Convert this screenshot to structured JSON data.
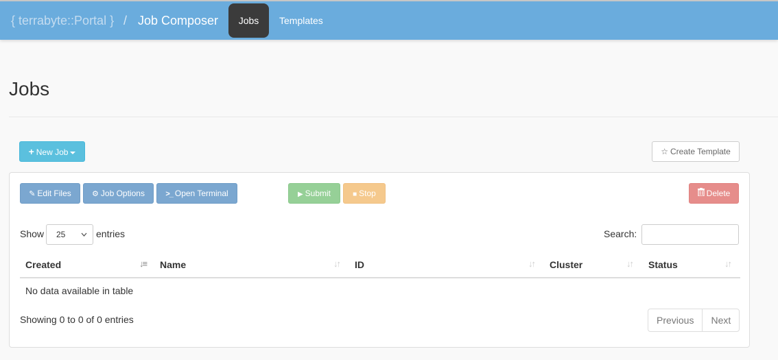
{
  "navbar": {
    "brand": "{ terrabyte::Portal }",
    "separator": "/",
    "app_title": "Job Composer",
    "items": [
      {
        "label": "Jobs",
        "active": true
      },
      {
        "label": "Templates",
        "active": false
      }
    ]
  },
  "page": {
    "title": "Jobs"
  },
  "toolbar": {
    "new_job": "New Job",
    "create_template": "Create Template",
    "edit_files": "Edit Files",
    "job_options": "Job Options",
    "open_terminal": "Open Terminal",
    "submit": "Submit",
    "stop": "Stop",
    "delete": "Delete"
  },
  "icons": {
    "plus": "+",
    "star": "☆",
    "edit": "✎",
    "gear": "⚙",
    "terminal": ">_",
    "play": "▶",
    "stop": "■",
    "trash": "🗑",
    "chevron_down": "⌄",
    "sort_both": "↓↑",
    "sort_desc": "↓≡"
  },
  "table": {
    "length_prefix": "Show",
    "length_value": "25",
    "length_suffix": "entries",
    "search_label": "Search:",
    "search_value": "",
    "columns": [
      "Created",
      "Name",
      "ID",
      "Cluster",
      "Status"
    ],
    "empty_message": "No data available in table",
    "info": "Showing 0 to 0 of 0 entries",
    "pagination": {
      "previous": "Previous",
      "next": "Next"
    }
  }
}
